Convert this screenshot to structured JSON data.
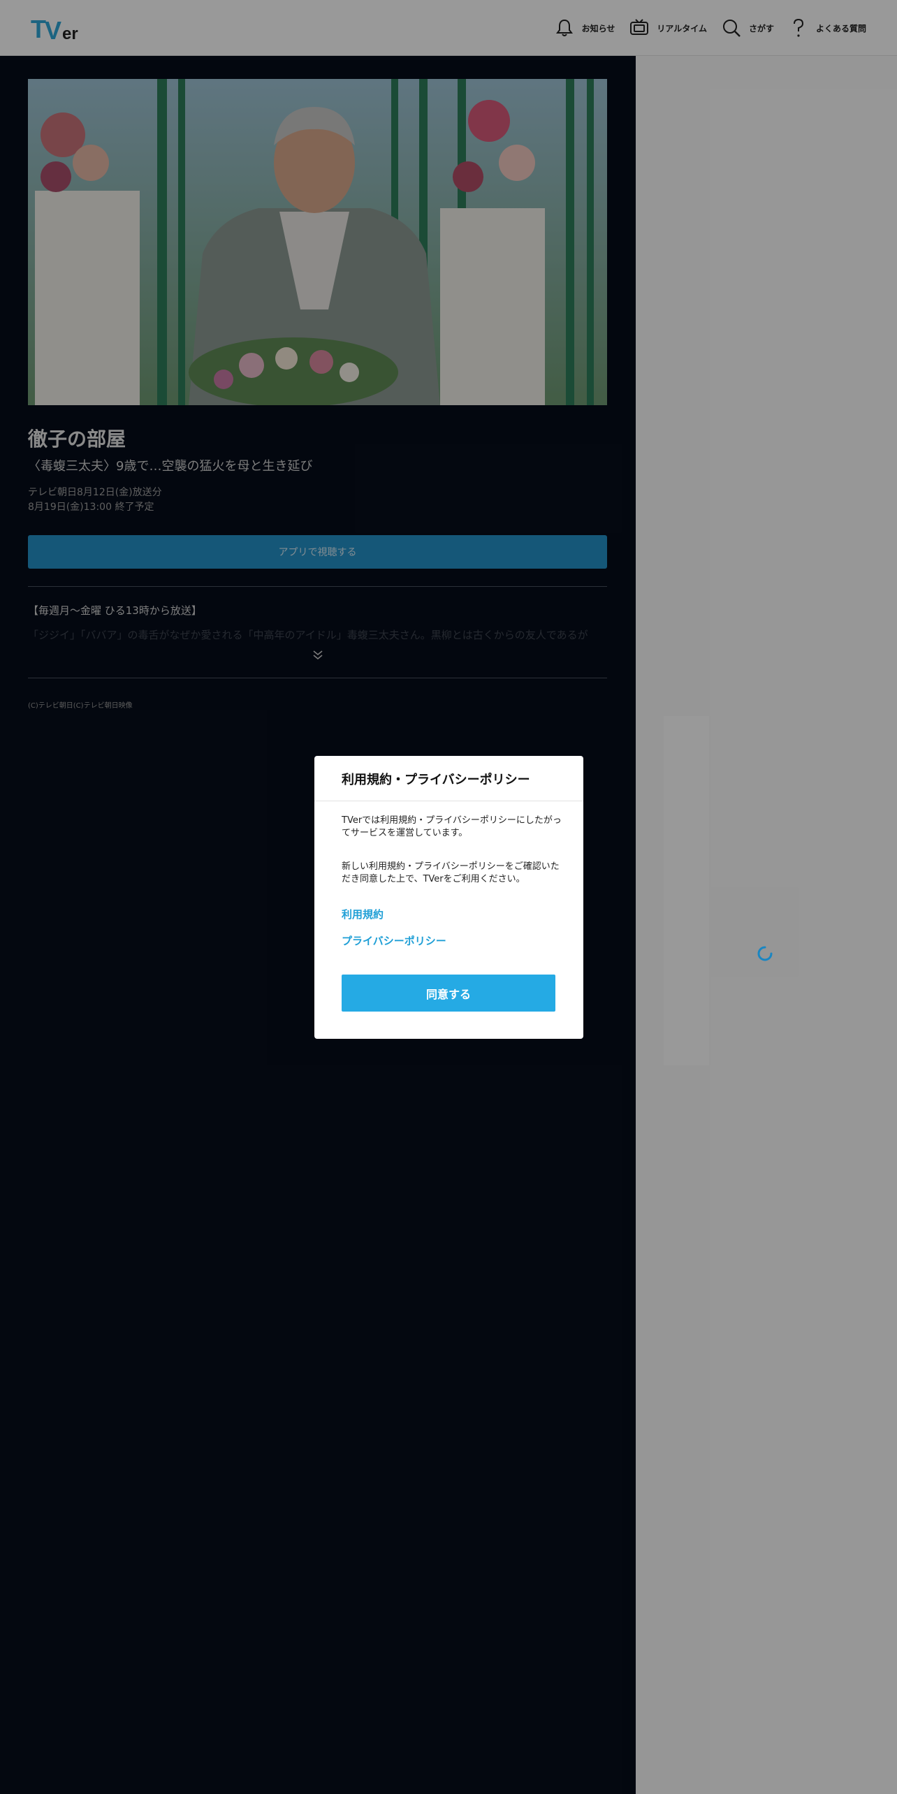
{
  "header": {
    "logo_text": "TVer",
    "nav": [
      {
        "label": "お知らせ",
        "icon": "bell-icon"
      },
      {
        "label": "リアルタイム",
        "icon": "tv-icon"
      },
      {
        "label": "さがす",
        "icon": "search-icon"
      },
      {
        "label": "よくある質問",
        "icon": "question-icon"
      }
    ]
  },
  "program": {
    "title": "徹子の部屋",
    "episode": "〈毒蝮三太夫〉9歳で…空襲の猛火を母と生き延び",
    "broadcast": "テレビ朝日8月12日(金)放送分",
    "expiry": "8月19日(金)13:00 終了予定",
    "watch_button": "アプリで視聴する",
    "description_lead": "【毎週月～金曜 ひる13時から放送】",
    "description_more": "「ジジイ」「ババア」の毒舌がなぜか愛される「中高年のアイドル」毒蝮三太夫さん。黒柳とは古くからの友人であるが",
    "copyright": "(C)テレビ朝日(C)テレビ朝日映像"
  },
  "modal": {
    "title": "利用規約・プライバシーポリシー",
    "text1": "TVerでは利用規約・プライバシーポリシーにしたがってサービスを運営しています。",
    "text2": "新しい利用規約・プライバシーポリシーをご確認いただき同意した上で、TVerをご利用ください。",
    "link_terms": "利用規約",
    "link_privacy": "プライバシーポリシー",
    "agree_button": "同意する"
  },
  "colors": {
    "accent": "#25aae4",
    "dark_bg": "#060d1a"
  }
}
